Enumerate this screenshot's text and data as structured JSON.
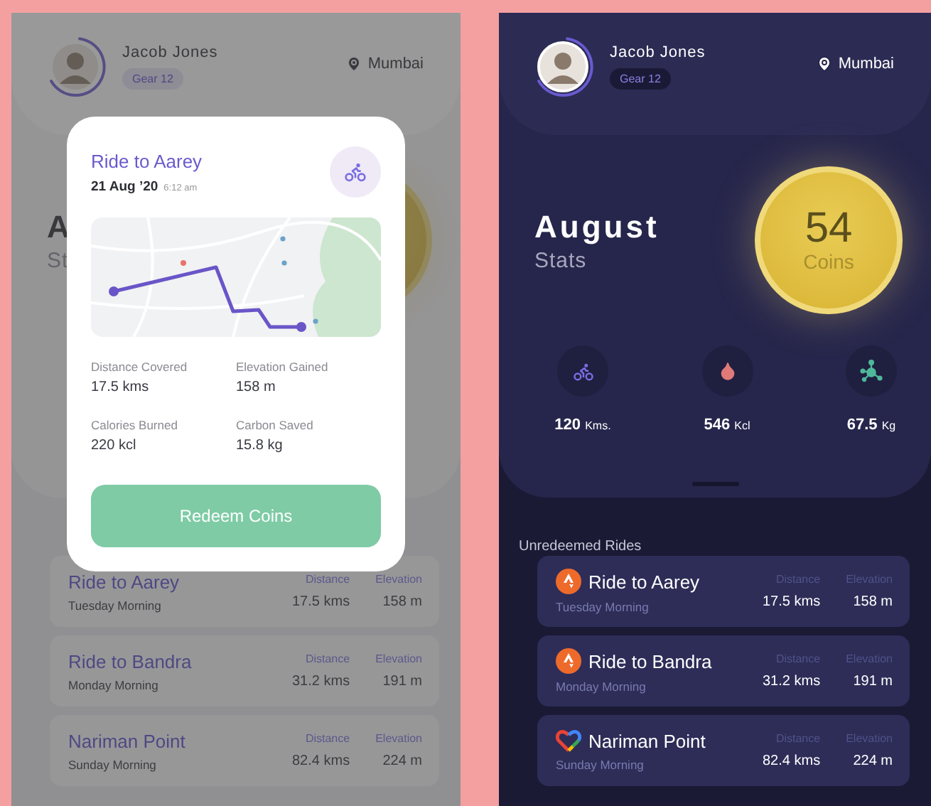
{
  "screens": [
    {
      "kind": "light",
      "dimmed": true,
      "user": {
        "name": "Jacob Jones",
        "gear": "Gear 12",
        "city": "Mumbai"
      },
      "month": "A",
      "subtitle": "St",
      "modal": {
        "title": "Ride to Aarey",
        "date": "21 Aug ’20",
        "time": "6:12 am",
        "stats": [
          {
            "label": "Distance Covered",
            "value": "17.5 kms"
          },
          {
            "label": "Elevation Gained",
            "value": "158 m"
          },
          {
            "label": "Calories Burned",
            "value": "220 kcl"
          },
          {
            "label": "Carbon Saved",
            "value": "15.8 kg"
          }
        ],
        "button": "Redeem Coins"
      },
      "rides": [
        {
          "title": "Ride to Aarey",
          "when": "Tuesday Morning",
          "distance_label": "Distance",
          "distance": "17.5 kms",
          "elevation_label": "Elevation",
          "elevation": "158 m"
        },
        {
          "title": "Ride to Bandra",
          "when": "Monday Morning",
          "distance_label": "Distance",
          "distance": "31.2 kms",
          "elevation_label": "Elevation",
          "elevation": "191 m"
        },
        {
          "title": "Nariman Point",
          "when": "Sunday Morning",
          "distance_label": "Distance",
          "distance": "82.4 kms",
          "elevation_label": "Elevation",
          "elevation": "224 m"
        }
      ]
    },
    {
      "kind": "dark",
      "dimmed": false,
      "user": {
        "name": "Jacob Jones",
        "gear": "Gear 12",
        "city": "Mumbai"
      },
      "month": "August",
      "subtitle": "Stats",
      "coin": {
        "value": "54",
        "label": "Coins"
      },
      "stats": [
        {
          "kind": "bike",
          "value": "120",
          "unit": "Kms."
        },
        {
          "kind": "drop",
          "value": "546",
          "unit": "Kcl"
        },
        {
          "kind": "molecule",
          "value": "67.5",
          "unit": "Kg"
        }
      ],
      "rides_title": "Unredeemed Rides",
      "rides": [
        {
          "kind": "peak",
          "title": "Ride to Aarey",
          "when": "Tuesday Morning",
          "distance_label": "Distance",
          "distance": "17.5 kms",
          "elevation_label": "Elevation",
          "elevation": "158 m"
        },
        {
          "kind": "peak",
          "title": "Ride to Bandra",
          "when": "Monday Morning",
          "distance_label": "Distance",
          "distance": "31.2 kms",
          "elevation_label": "Elevation",
          "elevation": "191 m"
        },
        {
          "kind": "heart",
          "title": "Nariman Point",
          "when": "Sunday Morning",
          "distance_label": "Distance",
          "distance": "82.4 kms",
          "elevation_label": "Elevation",
          "elevation": "224 m"
        }
      ]
    }
  ]
}
